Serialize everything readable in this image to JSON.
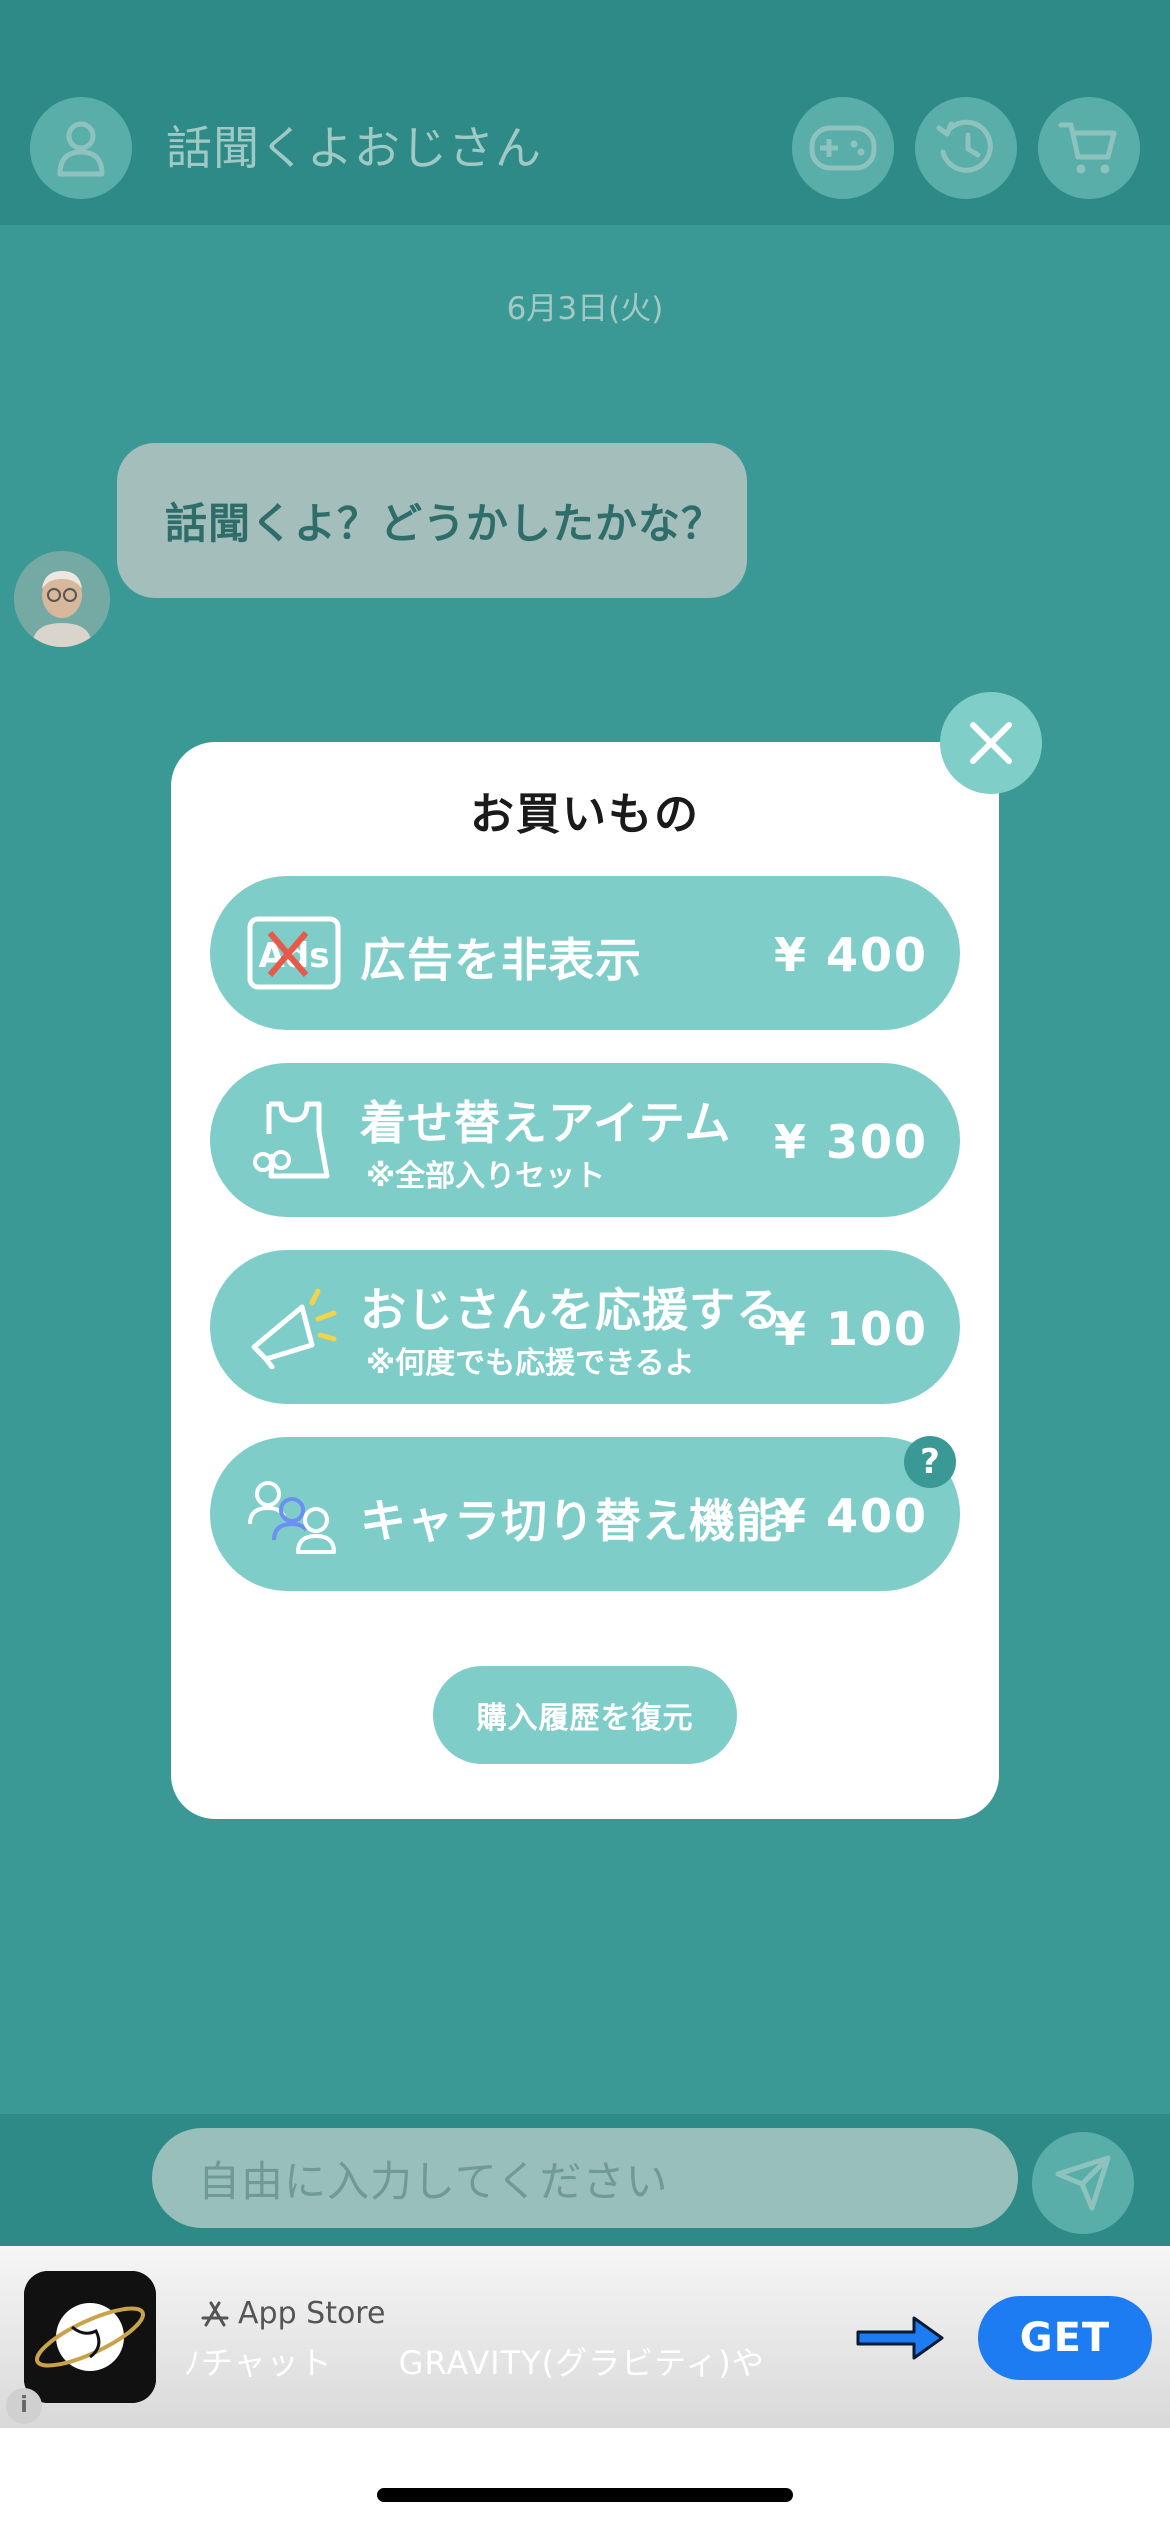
{
  "header": {
    "title": "話聞くよおじさん",
    "icons": [
      "user-icon",
      "gamepad-icon",
      "history-icon",
      "cart-icon"
    ]
  },
  "chat": {
    "date": "6月3日(火)",
    "message": "話聞くよ？どうかしたかな？"
  },
  "modal": {
    "title": "お買いもの",
    "items": [
      {
        "title": "広告を非表示",
        "subtitle": "",
        "price": "¥ 400",
        "icon": "no-ads-icon"
      },
      {
        "title": "着せ替えアイテム",
        "subtitle": "※全部入りセット",
        "price": "¥ 300",
        "icon": "outfit-icon"
      },
      {
        "title": "おじさんを応援する",
        "subtitle": "※何度でも応援できるよ",
        "price": "¥ 100",
        "icon": "megaphone-icon"
      },
      {
        "title": "キャラ切り替え機能",
        "subtitle": "",
        "price": "¥ 400",
        "icon": "switch-character-icon"
      }
    ],
    "help": "?",
    "restore_label": "購入履歴を復元"
  },
  "input": {
    "placeholder": "自由に入力してください"
  },
  "ad": {
    "store": "App Store",
    "text": "ﾉチャット　　GRAVITY(グラビティ)や",
    "get_label": "GET",
    "info": "i"
  },
  "colors": {
    "background": "#3a9995",
    "header": "#2e8a86",
    "item": "#7fcdc8",
    "get_button": "#1e7cf2"
  }
}
